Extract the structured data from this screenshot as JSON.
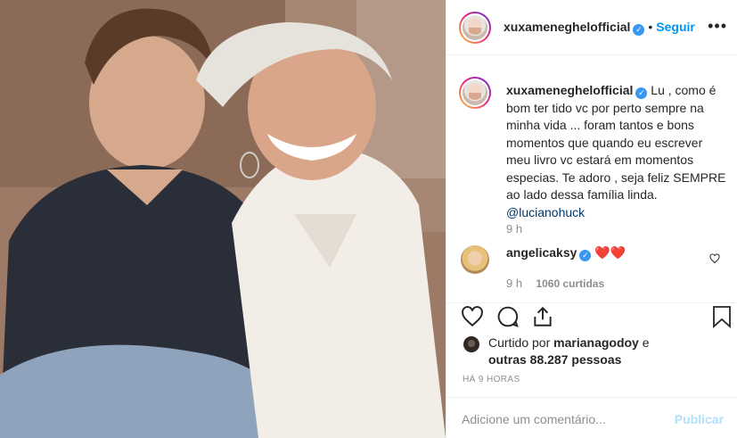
{
  "post": {
    "author": "xuxameneghelofficial",
    "follow_label": "Seguir",
    "separator": "•",
    "more_label": "•••"
  },
  "caption": {
    "username": "xuxameneghelofficial",
    "text": "Lu , como é bom ter tido vc por perto sempre na minha vida ... foram tantos e bons momentos que quando eu escrever meu livro vc estará em momentos especias. Te adoro , seja feliz SEMPRE ao lado dessa família linda.",
    "mention": "@lucianohuck",
    "time": "9 h"
  },
  "comment": {
    "username": "angelicaksy",
    "text": "❤️❤️",
    "time": "9 h",
    "likes": "1060 curtidas"
  },
  "likes": {
    "prefix": "Curtido por",
    "user": "marianagodoy",
    "middle": "e",
    "others": "outras 88.287 pessoas"
  },
  "post_time": "HÁ 9 HORAS",
  "add_comment": {
    "placeholder": "Adicione um comentário...",
    "publish_label": "Publicar"
  },
  "colors": {
    "accent": "#0095f6",
    "verified": "#3897f0",
    "heart": "#ed4956"
  }
}
